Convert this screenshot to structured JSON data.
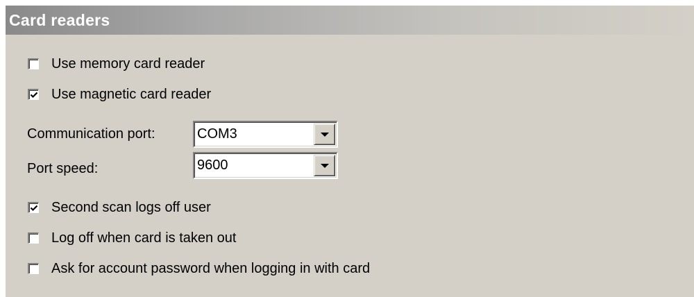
{
  "header": {
    "title": "Card readers"
  },
  "options": {
    "use_memory_card_reader": {
      "label": "Use memory card reader",
      "checked": false
    },
    "use_magnetic_card_reader": {
      "label": "Use magnetic card reader",
      "checked": true
    },
    "second_scan_logs_off": {
      "label": "Second scan logs off user",
      "checked": true
    },
    "log_off_card_taken_out": {
      "label": "Log off when card is taken out",
      "checked": false
    },
    "ask_password": {
      "label": "Ask for account password when logging in with card",
      "checked": false
    }
  },
  "communication_port": {
    "label": "Communication port:",
    "value": "COM3"
  },
  "port_speed": {
    "label": "Port speed:",
    "value": "9600"
  },
  "icons": {
    "dropdown": "chevron-down-icon",
    "check": "checkmark-icon"
  }
}
